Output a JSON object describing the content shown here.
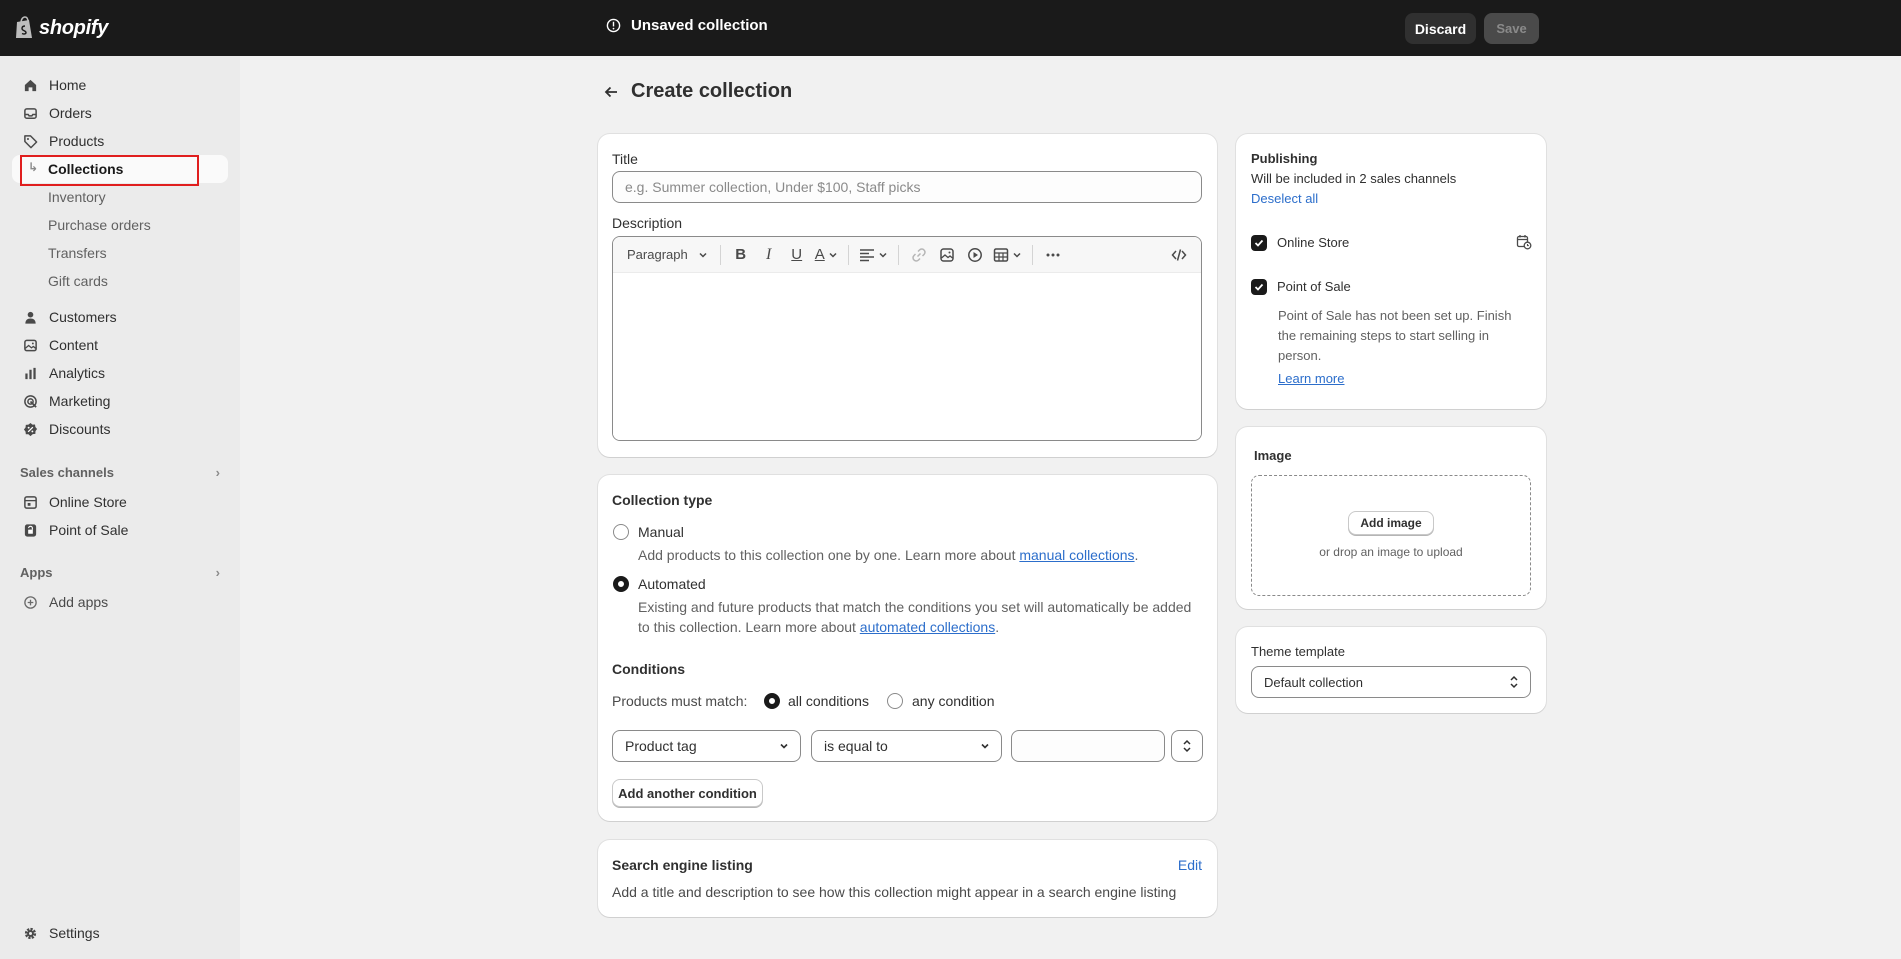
{
  "topbar": {
    "logo_text": "shopify",
    "status": "Unsaved collection",
    "discard_label": "Discard",
    "save_label": "Save"
  },
  "sidebar": {
    "items": [
      {
        "label": "Home",
        "icon": "home-icon"
      },
      {
        "label": "Orders",
        "icon": "inbox-icon"
      },
      {
        "label": "Products",
        "icon": "tag-icon"
      },
      {
        "label": "Collections"
      },
      {
        "label": "Inventory"
      },
      {
        "label": "Purchase orders"
      },
      {
        "label": "Transfers"
      },
      {
        "label": "Gift cards"
      },
      {
        "label": "Customers",
        "icon": "person-icon"
      },
      {
        "label": "Content",
        "icon": "image-icon"
      },
      {
        "label": "Analytics",
        "icon": "bar-chart-icon"
      },
      {
        "label": "Marketing",
        "icon": "target-icon"
      },
      {
        "label": "Discounts",
        "icon": "discount-icon"
      }
    ],
    "sales_channels_label": "Sales channels",
    "channels": [
      {
        "label": "Online Store",
        "icon": "store-icon"
      },
      {
        "label": "Point of Sale",
        "icon": "pos-icon"
      }
    ],
    "apps_label": "Apps",
    "add_apps_label": "Add apps",
    "settings_label": "Settings"
  },
  "page": {
    "title": "Create collection"
  },
  "main_card": {
    "title_label": "Title",
    "title_placeholder": "e.g. Summer collection, Under $100, Staff picks",
    "description_label": "Description",
    "paragraph_select": "Paragraph"
  },
  "collection_type": {
    "heading": "Collection type",
    "manual_label": "Manual",
    "manual_help": "Add products to this collection one by one. Learn more about ",
    "manual_link": "manual collections",
    "automated_label": "Automated",
    "automated_help_1": "Existing and future products that match the conditions you set will automatically be added",
    "automated_help_2": "to this collection. Learn more about ",
    "automated_link": "automated collections",
    "selected": "Automated",
    "conditions_heading": "Conditions",
    "match_label": "Products must match:",
    "all_conditions": "all conditions",
    "any_condition": "any condition",
    "match_selected": "all conditions",
    "field_select": "Product tag",
    "operator_select": "is equal to",
    "condition_value": "",
    "add_condition": "Add another condition"
  },
  "seo": {
    "heading": "Search engine listing",
    "edit_label": "Edit",
    "help": "Add a title and description to see how this collection might appear in a search engine listing"
  },
  "publishing": {
    "heading": "Publishing",
    "subtitle": "Will be included in 2 sales channels",
    "deselect_all": "Deselect all",
    "online_store": "Online Store",
    "pos": "Point of Sale",
    "pos_help_1": "Point of Sale has not been set up. Finish",
    "pos_help_2": "the remaining steps to start selling in",
    "pos_help_3": "person.",
    "learn_more": "Learn more"
  },
  "image_card": {
    "heading": "Image",
    "add_image": "Add image",
    "drop_hint": "or drop an image to upload"
  },
  "theme": {
    "label": "Theme template",
    "value": "Default collection"
  }
}
